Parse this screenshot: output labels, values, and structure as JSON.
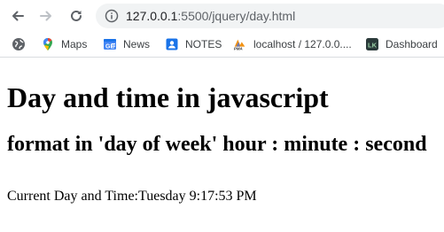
{
  "browser": {
    "url_host": "127.0.0.1",
    "url_port_path": ":5500/jquery/day.html"
  },
  "bookmarks": [
    {
      "label": "",
      "icon": "globe-icon"
    },
    {
      "label": "Maps",
      "icon": "maps-pin-icon"
    },
    {
      "label": "News",
      "icon": "news-icon"
    },
    {
      "label": "NOTES",
      "icon": "notes-icon"
    },
    {
      "label": "localhost / 127.0.0....",
      "icon": "phpmyadmin-icon"
    },
    {
      "label": "Dashboard",
      "icon": "dashboard-icon"
    }
  ],
  "page": {
    "heading": "Day and time in javascript",
    "subheading": "format in 'day of week' hour : minute : second",
    "result_label": "Current Day and Time:",
    "result_value": "Tuesday 9:17:53 PM"
  },
  "colors": {
    "omnibox_bg": "#f1f3f4",
    "maps_red": "#ea4335",
    "news_blue": "#4285f4",
    "notes_blue": "#1a73e8"
  }
}
